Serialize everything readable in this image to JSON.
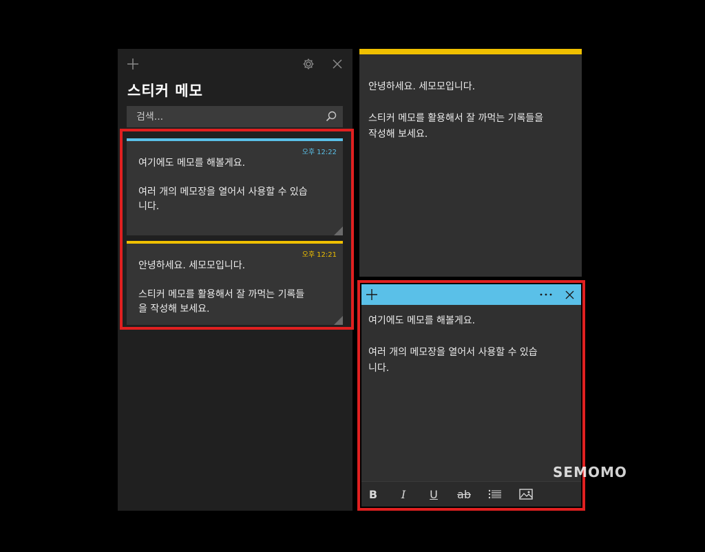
{
  "list": {
    "title": "스티커 메모",
    "search_placeholder": "검색...",
    "notes": [
      {
        "time_prefix": "오후",
        "time": "12:22",
        "color": "#5ac0e8",
        "text": "여기에도 메모를 해볼게요.\n\n여러 개의 메모장을 열어서 사용할 수 있습\n니다."
      },
      {
        "time_prefix": "오후",
        "time": "12:21",
        "color": "#f0c000",
        "text": "안녕하세요. 세모모입니다.\n\n스티커 메모를 활용해서 잘 까먹는 기록들\n을 작성해 보세요."
      }
    ]
  },
  "note_yellow": {
    "color": "#f0c000",
    "text": "안녕하세요. 세모모입니다.\n\n스티커 메모를 활용해서 잘 까먹는 기록들을\n작성해 보세요."
  },
  "note_blue": {
    "color": "#5ac0e8",
    "text": "여기에도 메모를 해볼게요.\n\n여러 개의 메모장을 열어서 사용할 수 있습\n니다."
  },
  "icons": {
    "add": "plus-icon",
    "settings": "gear-icon",
    "close": "close-icon",
    "search": "search-icon",
    "more": "more-icon"
  },
  "toolbar": {
    "bold": "B",
    "italic": "I",
    "underline": "U",
    "strike": "ab"
  },
  "watermark": "SEMOMO",
  "highlight_color": "#e02020"
}
